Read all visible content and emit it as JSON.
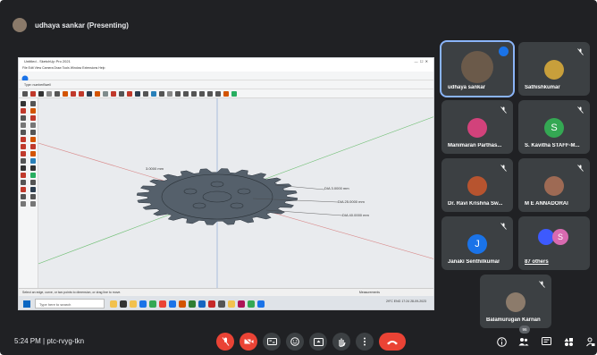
{
  "presenter": {
    "title": "udhaya sankar (Presenting)"
  },
  "share": {
    "window_title": "Untitled - SketchUp Pro 2021",
    "menu": "File  Edit  View  Camera  Draw  Tools  Window  Extensions  Help",
    "layer": "Type: numberBwell",
    "dims": {
      "d1": "DIA 3.0000 mm",
      "d2": "DIA 25.0000 mm",
      "d3": "DIA 40.0000 mm",
      "left_dim": "3.0000 mm"
    },
    "status": "Select an edge, curve, or two points to dimension, or drag line to move.",
    "status_right": "Measurements",
    "taskbar_search": "Type here to search",
    "tray": "29°C  ENG  17:24  28-09-2023"
  },
  "participants": [
    {
      "name": "udhaya sankar",
      "avatar_color": "#6b5a4a",
      "speaking": true
    },
    {
      "name": "Sathishkumar",
      "avatar_color": "#c89f3b",
      "mic": "off"
    },
    {
      "name": "Manimaran Parthas...",
      "avatar_color": "#d2427b",
      "mic": "off"
    },
    {
      "name": "S. Kavitha STAFF-M...",
      "avatar_letter": "S",
      "avatar_color": "#34a853",
      "mic": "off"
    },
    {
      "name": "Dr. Ravi Krishna Sw...",
      "avatar_color": "#b7542f",
      "mic": "off"
    },
    {
      "name": "M E ANNADORAI",
      "avatar_color": "#9e6a54",
      "mic": "off"
    },
    {
      "name": "Janaki Senthilkumar",
      "avatar_letter": "J",
      "avatar_color": "#1a73e8",
      "mic": "off"
    },
    {
      "name": "87 others",
      "avatar_letter": "S",
      "avatar_color": "#d86ab0",
      "mic": "off"
    },
    {
      "name": "Balamurugan Karnan",
      "avatar_color": "#8c7b6b",
      "mic": "off"
    }
  ],
  "footer": {
    "time": "5:24 PM",
    "separator": "|",
    "meeting_code": "ptc-rvyg-tkn",
    "people_count": "96"
  },
  "colors": {
    "bg": "#202124",
    "tile": "#3c4043",
    "danger": "#ea4335",
    "accent": "#1a73e8"
  }
}
